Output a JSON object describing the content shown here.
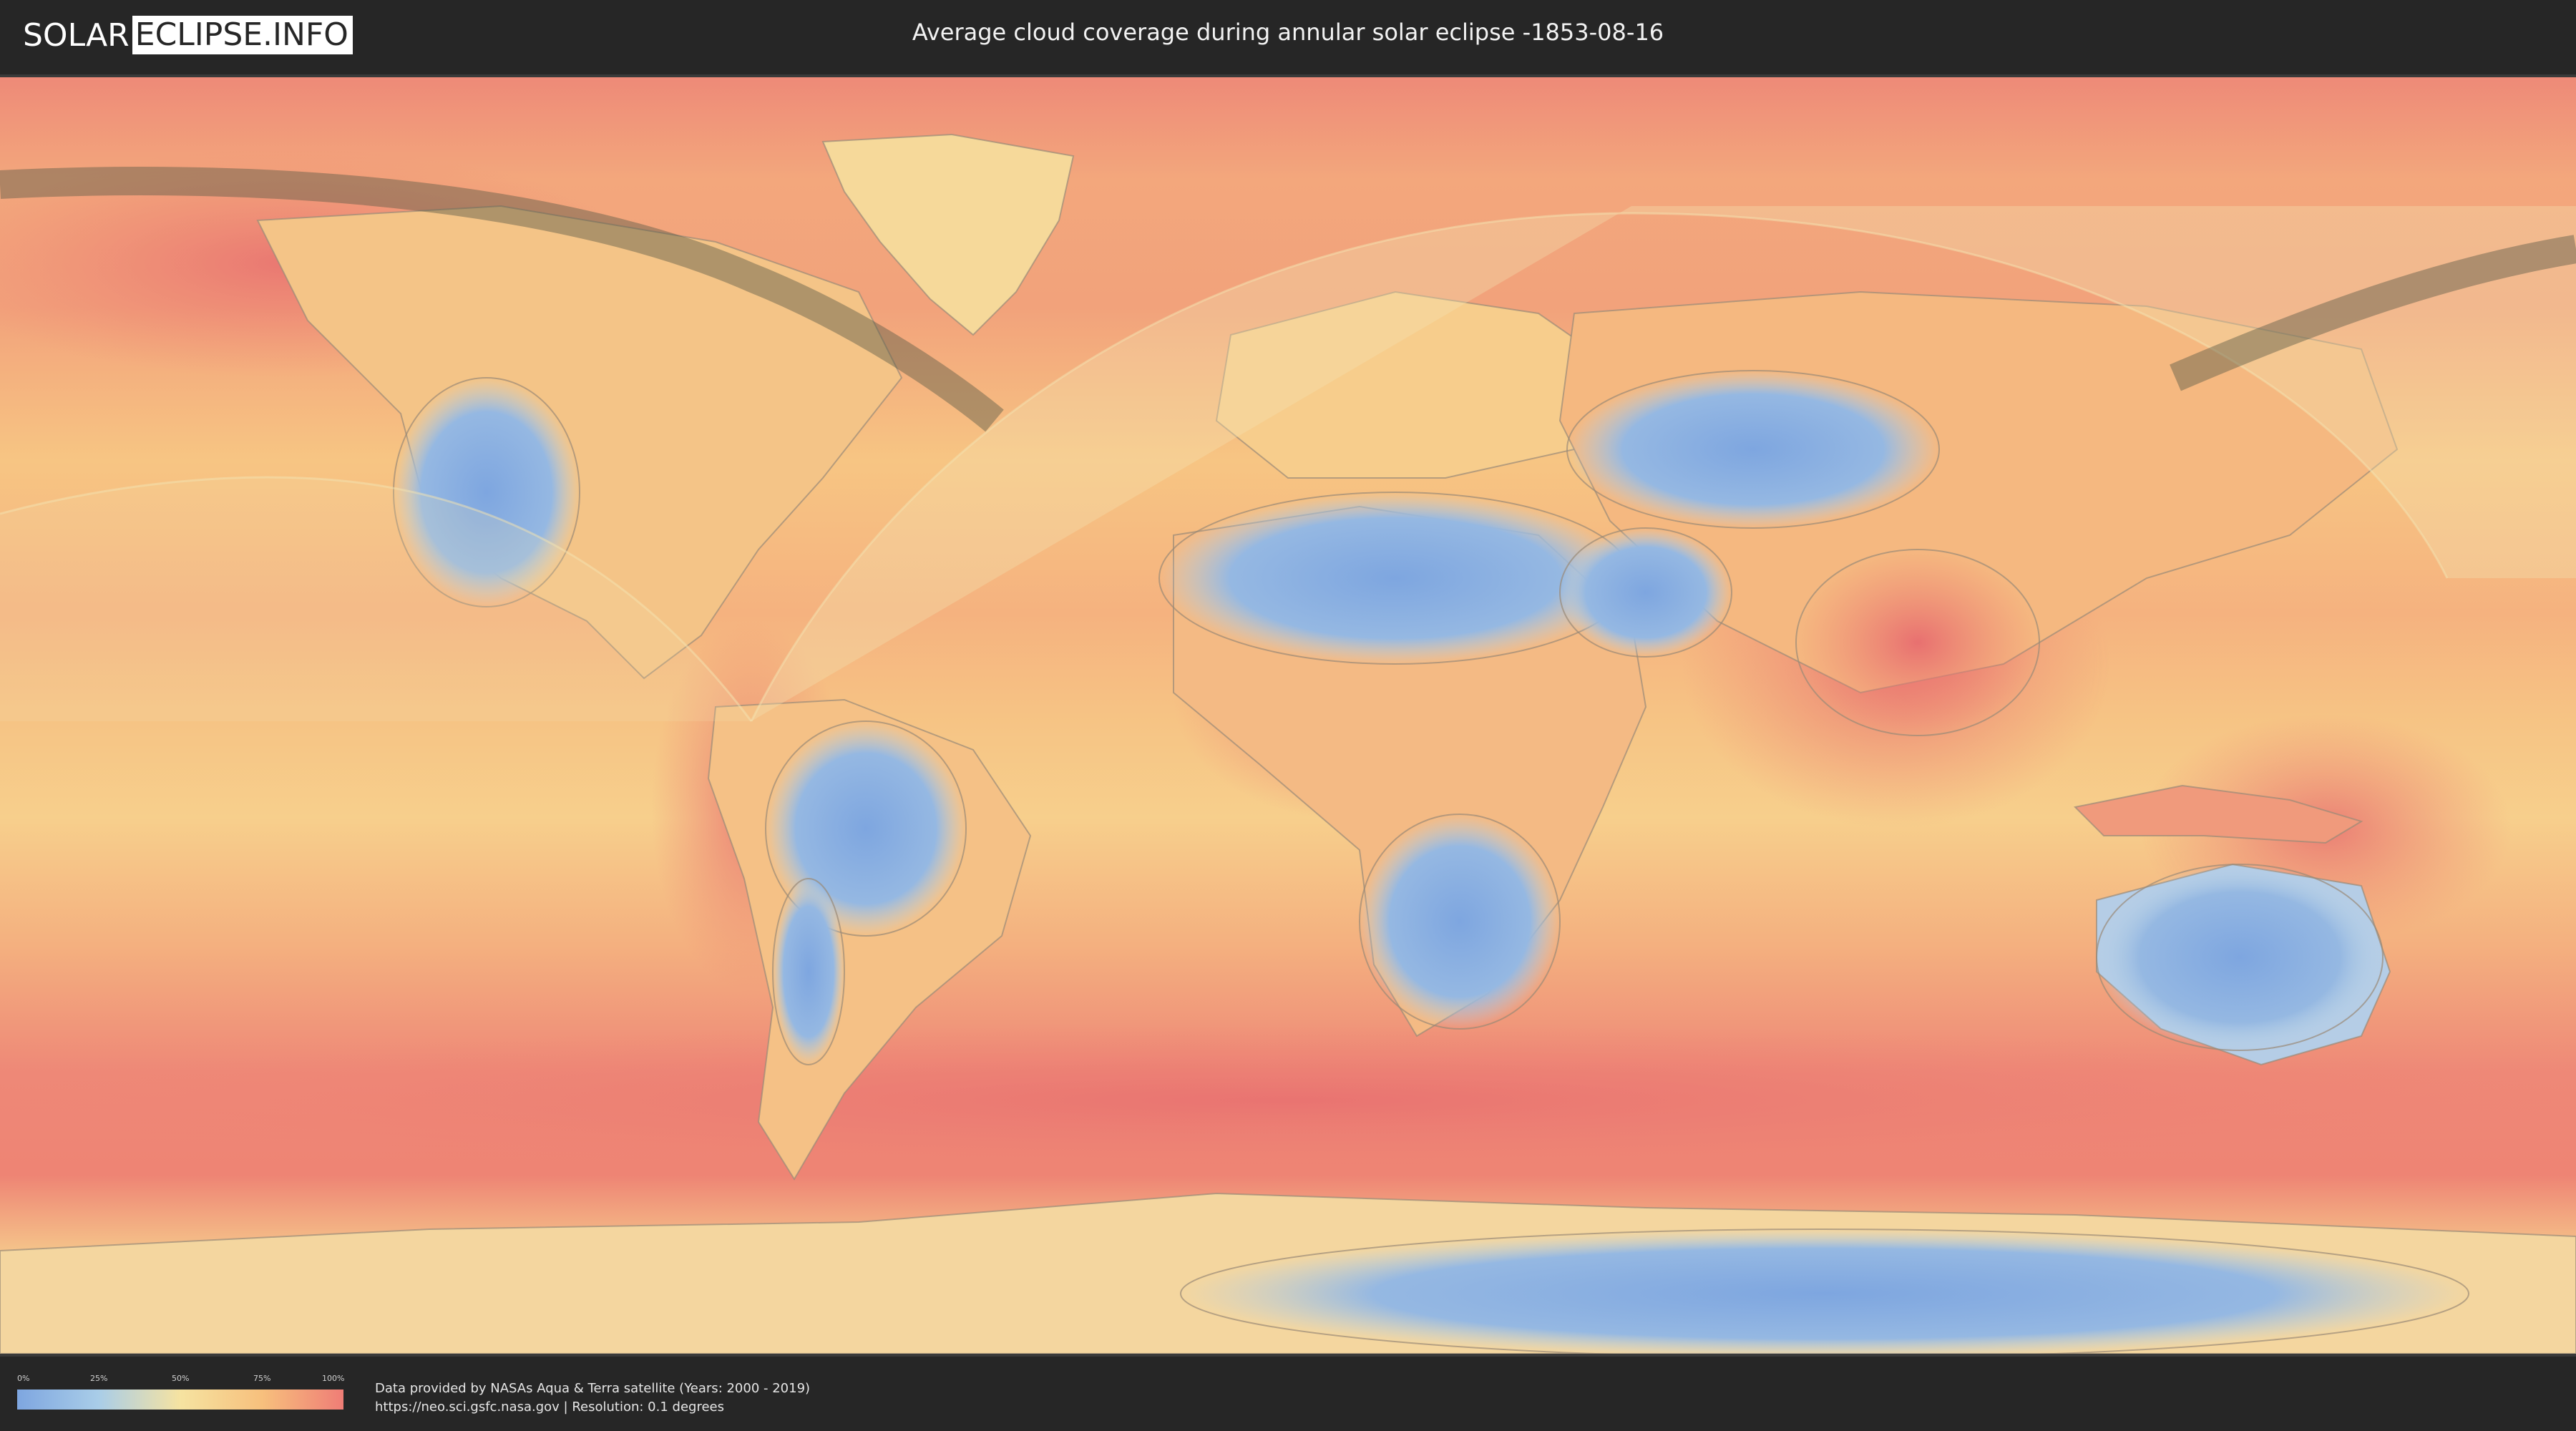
{
  "header": {
    "logo_left": "SOLAR",
    "logo_right": "ECLIPSE.INFO",
    "title": "Average cloud coverage during annular solar eclipse -1853-08-16"
  },
  "legend": {
    "ticks": [
      "0%",
      "25%",
      "50%",
      "75%",
      "100%"
    ],
    "colors": [
      "#7ea6e0",
      "#a9cde8",
      "#f6e3a1",
      "#f7c07d",
      "#ef7d76"
    ]
  },
  "footer": {
    "credit_line1": "Data provided by NASAs Aqua & Terra satellite (Years: 2000 - 2019)",
    "credit_line2": "https://neo.sci.gsfc.nasa.gov | Resolution: 0.1 degrees"
  },
  "colors": {
    "background": "#262626",
    "cloud_high": "#ef7d76",
    "cloud_mid": "#f6c67f",
    "cloud_low": "#7ea6e0",
    "eclipse_path": "#5b5b47"
  }
}
